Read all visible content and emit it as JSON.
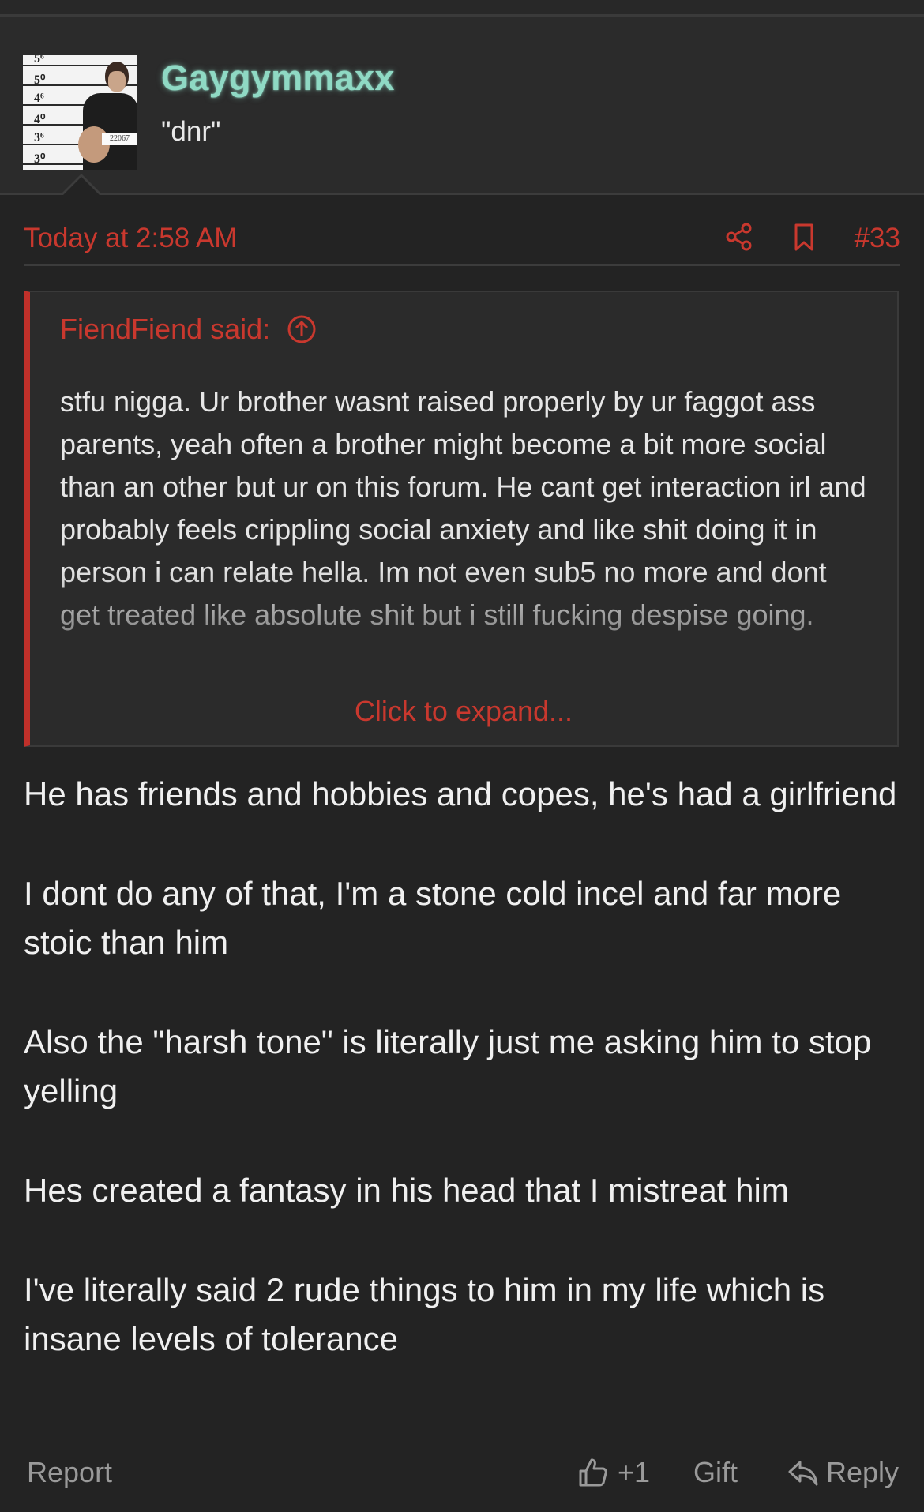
{
  "user": {
    "name": "Gaygymmaxx",
    "title": "\"dnr\"",
    "avatar_marks": [
      "5⁶",
      "5⁰",
      "4⁶",
      "4⁰",
      "3⁶",
      "3⁰"
    ],
    "avatar_placard": "22067"
  },
  "post": {
    "timestamp": "Today at 2:58 AM",
    "number": "#33",
    "quote": {
      "author_label": "FiendFiend said:",
      "text": "stfu nigga. Ur brother wasnt raised properly by ur faggot ass parents, yeah often a brother might become a bit more social than an other but ur on this forum. He cant get interaction irl and probably feels crippling social anxiety and like shit doing it in person i can relate hella. Im not even sub5 no more and dont get treated like absolute shit but i still fucking despise going.",
      "expand_label": "Click to expand..."
    },
    "paragraphs": [
      "He has friends and hobbies and copes, he's had a girlfriend",
      "I dont do any of that, I'm a stone cold incel and far more stoic than him",
      "Also the \"harsh tone\" is literally just me asking him to stop yelling",
      "Hes created a fantasy in his head that I mistreat him",
      "I've literally said 2 rude things to him in my life which is insane levels of tolerance"
    ]
  },
  "footer": {
    "report_label": "Report",
    "like_label": "+1",
    "gift_label": "Gift",
    "reply_label": "Reply"
  },
  "icons": {
    "share": "share-icon",
    "bookmark": "bookmark-icon",
    "quote_jump": "arrow-up-circle-icon",
    "like": "thumbs-up-icon",
    "reply": "reply-arrow-icon"
  },
  "colors": {
    "background": "#232323",
    "panel": "#2b2b2b",
    "accent_red": "#c9382e",
    "username": "#8fd9c4"
  }
}
